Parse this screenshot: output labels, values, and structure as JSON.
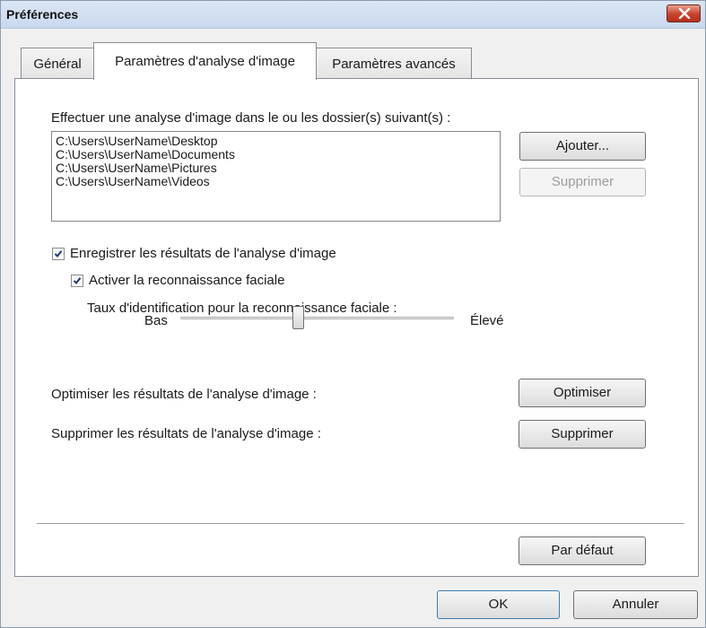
{
  "window": {
    "title": "Préférences"
  },
  "tabs": [
    {
      "label": "Général",
      "active": false
    },
    {
      "label": "Paramètres d'analyse d'image",
      "active": true
    },
    {
      "label": "Paramètres avancés",
      "active": false
    }
  ],
  "folders": {
    "label": "Effectuer une analyse d'image dans le ou les dossier(s) suivant(s) :",
    "items": [
      "C:\\Users\\UserName\\Desktop",
      "C:\\Users\\UserName\\Documents",
      "C:\\Users\\UserName\\Pictures",
      "C:\\Users\\UserName\\Videos"
    ],
    "add_label": "Ajouter...",
    "remove_label": "Supprimer"
  },
  "save_results": {
    "label": "Enregistrer les résultats de l'analyse d'image",
    "checked": true
  },
  "face_recognition": {
    "label": "Activer la reconnaissance faciale",
    "checked": true
  },
  "face_rate": {
    "label": "Taux d'identification pour la reconnaissance faciale :",
    "low_label": "Bas",
    "high_label": "Élevé",
    "level": 0.43
  },
  "optimize": {
    "label": "Optimiser les résultats de l'analyse d'image :",
    "button": "Optimiser"
  },
  "delete_results": {
    "label": "Supprimer les résultats de l'analyse d'image :",
    "button": "Supprimer"
  },
  "defaults_button": "Par défaut",
  "footer": {
    "ok": "OK",
    "cancel": "Annuler"
  },
  "colors": {
    "close_button": "#c8412c",
    "title_bar": "#dbe6f4"
  }
}
